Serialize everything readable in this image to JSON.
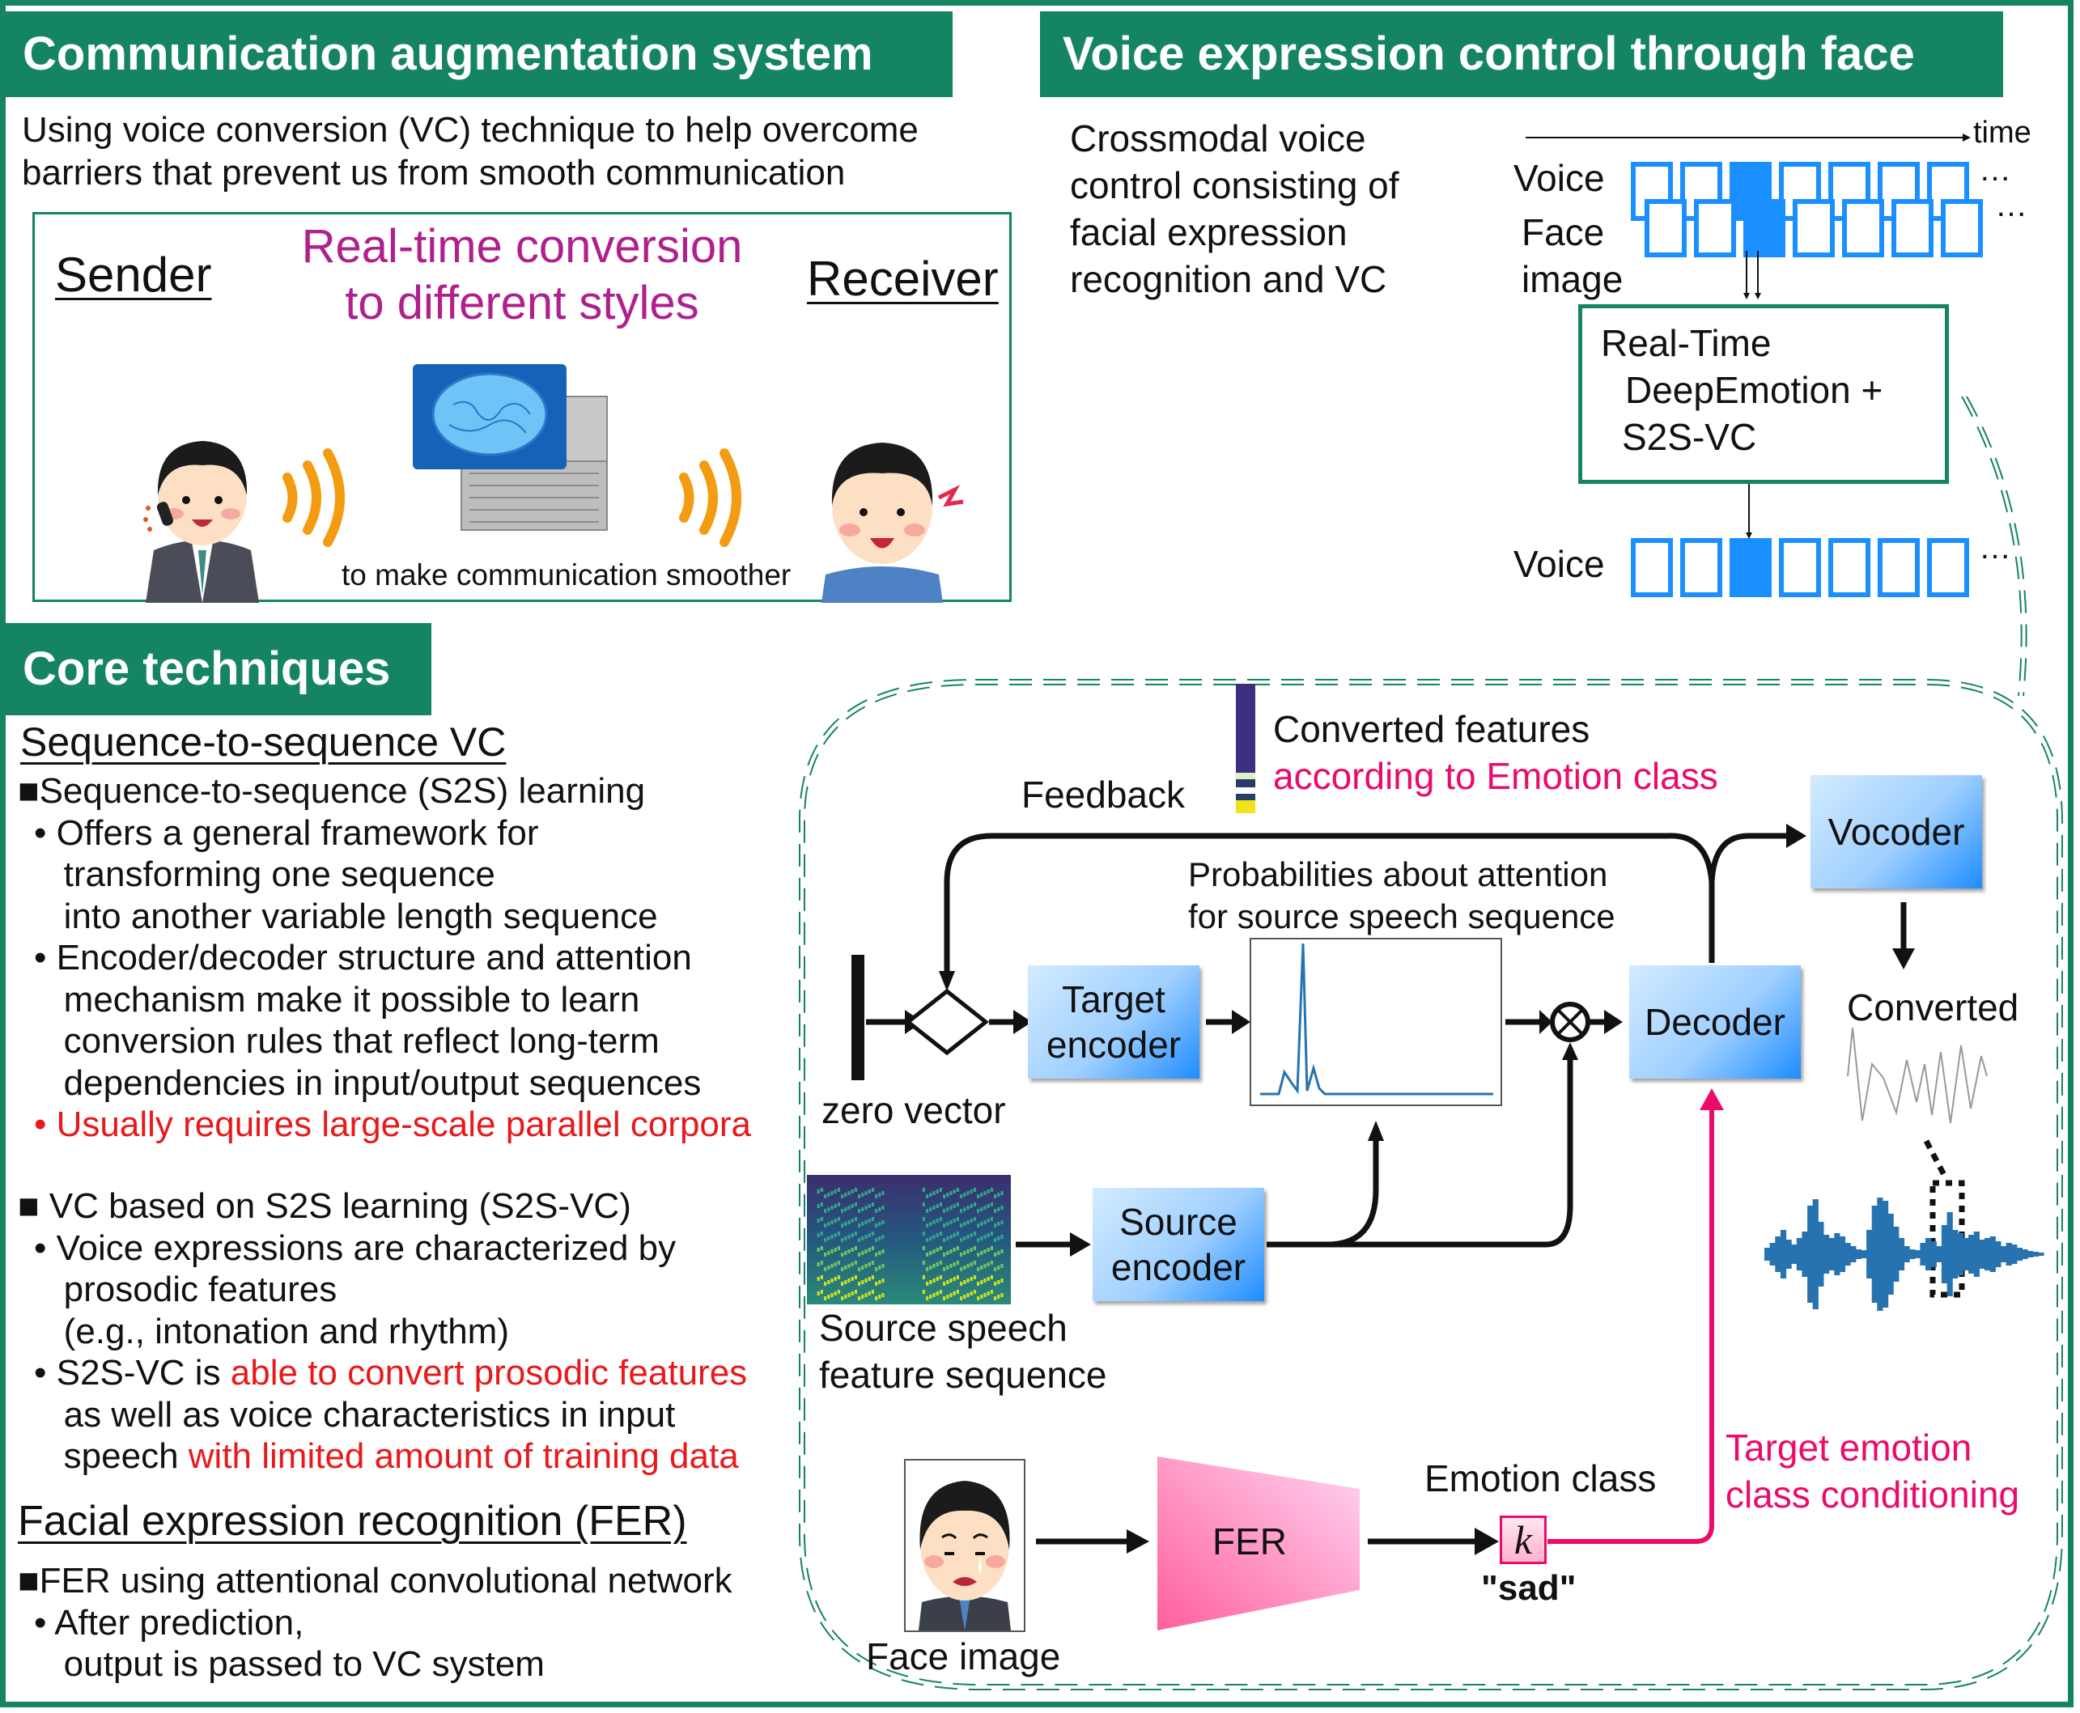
{
  "sections": {
    "comm": {
      "title": "Communication augmentation system",
      "intro": [
        "Using voice conversion (VC) technique to help overcome",
        "barriers that prevent us from smooth communication"
      ],
      "panel": {
        "sender": "Sender",
        "receiver": "Receiver",
        "headline": [
          "Real-time conversion",
          "to different styles"
        ],
        "caption": "to make communication smoother",
        "icons": [
          "sender-person-icon",
          "sound-wave-icon",
          "ai-brain-server-icon",
          "sound-wave-icon",
          "receiver-person-icon"
        ]
      }
    },
    "voice_control": {
      "title": "Voice expression control through face",
      "description": [
        "Crossmodal voice",
        "control consisting of",
        "facial expression",
        "recognition and VC"
      ],
      "timeline": {
        "time_label": "time",
        "voice_label": "Voice",
        "face_label": [
          "Face",
          "image"
        ],
        "ellipsis": "…",
        "cells": 7,
        "highlight_index": 2,
        "model_box": [
          "Real-Time",
          "DeepEmotion +",
          "S2S-VC"
        ],
        "output_label": "Voice"
      }
    },
    "core": {
      "title": "Core techniques",
      "s2s_heading": "Sequence-to-sequence VC",
      "s2s_learning": {
        "heading": "■Sequence-to-sequence (S2S) learning",
        "bullets": [
          {
            "lines": [
              "• Offers a general framework for",
              "   transforming one sequence",
              "   into another variable length sequence"
            ]
          },
          {
            "lines": [
              "• Encoder/decoder structure and attention",
              "   mechanism make it possible to learn",
              "   conversion rules that reflect long-term",
              "   dependencies in input/output sequences"
            ]
          },
          {
            "red": "• Usually requires large-scale parallel corpora"
          }
        ]
      },
      "s2s_vc": {
        "heading": "■ VC based on S2S learning (S2S-VC)",
        "bullet1": [
          "• Voice expressions are characterized by",
          "   prosodic features",
          "   (e.g., intonation and rhythm)"
        ],
        "bullet2": {
          "l1_a": "• S2S-VC is ",
          "l1_b": "able to convert prosodic features",
          "l2": "   as well as voice characteristics in input",
          "l3_a": "   speech ",
          "l3_b": "with limited amount of training data"
        }
      },
      "fer_heading": "Facial expression recognition (FER)",
      "fer": {
        "heading": "■FER using attentional convolutional network",
        "bullet": [
          "• After prediction,",
          "   output is passed to VC system"
        ]
      }
    },
    "pipeline": {
      "converted_features": "Converted features",
      "according": "according to Emotion class",
      "feedback": "Feedback",
      "vocoder": "Vocoder",
      "attention_title": [
        "Probabilities about attention",
        "for source speech sequence"
      ],
      "target_encoder": [
        "Target",
        "encoder"
      ],
      "decoder": "Decoder",
      "converted": "Converted",
      "zero_vector": "zero vector",
      "source_encoder": [
        "Source",
        "encoder"
      ],
      "source_speech": [
        "Source speech",
        "feature sequence"
      ],
      "emotion_class": "Emotion class",
      "emotion_symbol": "k",
      "emotion_value": "\"sad\"",
      "fer": "FER",
      "face_image": "Face image",
      "target_conditioning": [
        "Target emotion",
        "class conditioning"
      ]
    }
  },
  "colors": {
    "brand_green": "#148463",
    "cell_blue": "#1a8fff",
    "emphasis_red": "#e8191b",
    "emotion_pink": "#ea0b6b",
    "headline_magenta": "#b0208d",
    "wave_blue": "#2673b0",
    "sound_orange": "#f39c12"
  }
}
